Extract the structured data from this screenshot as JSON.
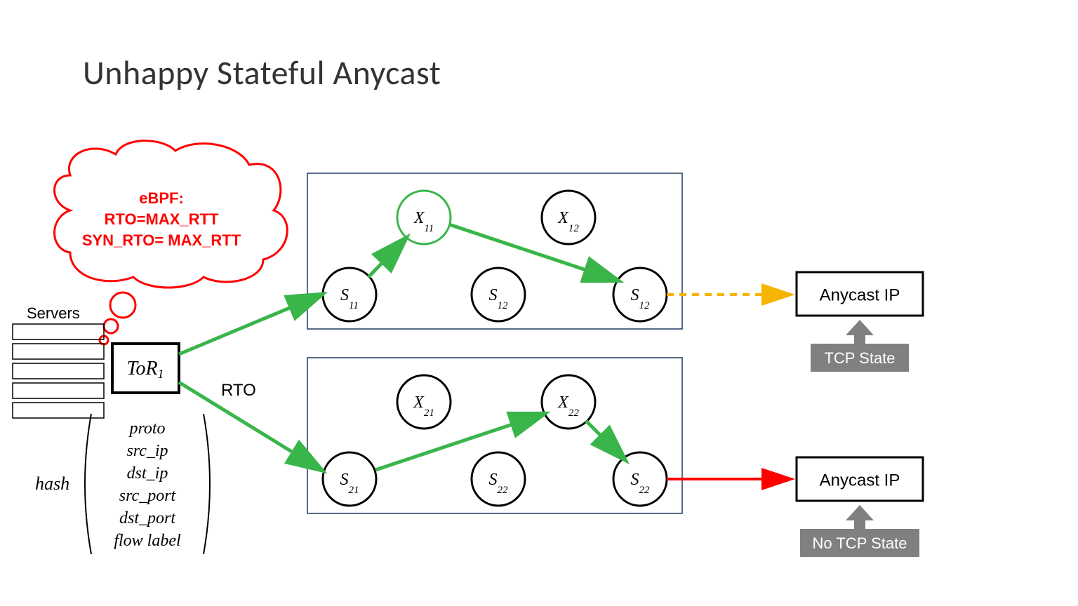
{
  "title": "Unhappy Stateful Anycast",
  "thought_bubble": {
    "line1": "eBPF:",
    "line2": "RTO=MAX_RTT",
    "line3": "SYN_RTO= MAX_RTT"
  },
  "servers_label": "Servers",
  "tor_label": "ToR",
  "tor_sub": "1",
  "rto_label": "RTO",
  "hash_prefix": "hash",
  "hash_tuple": [
    "proto",
    "src_ip",
    "dst_ip",
    "src_port",
    "dst_port",
    "flow label"
  ],
  "nodes": {
    "x11": {
      "base": "X",
      "sub": "11"
    },
    "x12": {
      "base": "X",
      "sub": "12"
    },
    "s11": {
      "base": "S",
      "sub": "11"
    },
    "s12a": {
      "base": "S",
      "sub": "12"
    },
    "s12b": {
      "base": "S",
      "sub": "12"
    },
    "x21": {
      "base": "X",
      "sub": "21"
    },
    "x22": {
      "base": "X",
      "sub": "22"
    },
    "s21": {
      "base": "S",
      "sub": "21"
    },
    "s22a": {
      "base": "S",
      "sub": "22"
    },
    "s22b": {
      "base": "S",
      "sub": "22"
    }
  },
  "anycast_box_top": "Anycast IP",
  "anycast_box_bottom": "Anycast IP",
  "state_top": "TCP State",
  "state_bottom": "No TCP State",
  "colors": {
    "green": "#39b54a",
    "red": "#ff0000",
    "orange": "#f5b400",
    "gray": "#808080",
    "navy": "#1f3864"
  }
}
